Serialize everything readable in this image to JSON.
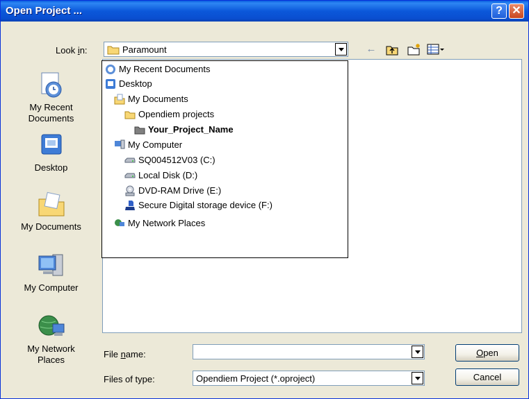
{
  "window": {
    "title": "Open Project ...",
    "help_glyph": "?",
    "close_glyph": "✕"
  },
  "lookin": {
    "label_pre": "Look ",
    "label_key": "i",
    "label_post": "n:",
    "value": "Paramount"
  },
  "toolbar": {
    "back": "←",
    "up_folder": "⬑",
    "new_folder": "✶",
    "views": "▦▾"
  },
  "places": [
    {
      "label": "My Recent Documents",
      "icon": "recent-documents-icon"
    },
    {
      "label": "Desktop",
      "icon": "desktop-icon"
    },
    {
      "label": "My Documents",
      "icon": "my-documents-icon"
    },
    {
      "label": "My Computer",
      "icon": "my-computer-icon"
    },
    {
      "label": "My Network Places",
      "icon": "network-places-icon"
    }
  ],
  "dropdown": [
    {
      "label": "My Recent Documents",
      "icon": "recent-icon"
    },
    {
      "label": "Desktop",
      "icon": "desktop-icon"
    },
    {
      "label": "My Documents",
      "icon": "documents-icon"
    },
    {
      "label": "Opendiem projects",
      "icon": "folder-icon"
    },
    {
      "label": "Your_Project_Name",
      "icon": "folder-icon"
    },
    {
      "label": "My Computer",
      "icon": "computer-icon"
    },
    {
      "label": "SQ004512V03 (C:)",
      "icon": "drive-icon"
    },
    {
      "label": "Local Disk (D:)",
      "icon": "drive-icon"
    },
    {
      "label": "DVD-RAM Drive (E:)",
      "icon": "dvd-icon"
    },
    {
      "label": "Secure Digital storage device (F:)",
      "icon": "sd-card-icon"
    },
    {
      "label": "My Network Places",
      "icon": "network-icon"
    }
  ],
  "filename": {
    "label_pre": "File ",
    "label_key": "n",
    "label_post": "ame:",
    "value": ""
  },
  "filetype": {
    "label": "Files of type:",
    "value": "Opendiem Project (*.oproject)"
  },
  "buttons": {
    "open_key": "O",
    "open_rest": "pen",
    "cancel": "Cancel"
  }
}
